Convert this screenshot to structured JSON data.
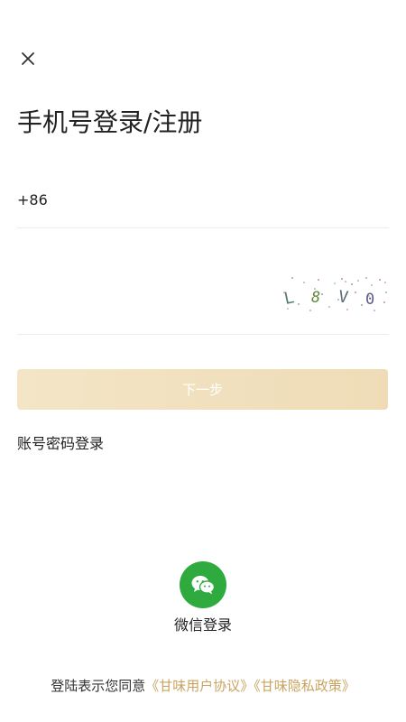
{
  "header": {
    "close_icon": "close-icon",
    "title": "手机号登录/注册"
  },
  "phone": {
    "country_code": "+86",
    "value": "",
    "placeholder": ""
  },
  "captcha": {
    "value": "",
    "placeholder": "",
    "code_text": "L8V0"
  },
  "actions": {
    "next_label": "下一步",
    "password_login_label": "账号密码登录"
  },
  "social": {
    "wechat_icon": "wechat-icon",
    "wechat_label": "微信登录",
    "wechat_color": "#2faa3f"
  },
  "agreement": {
    "prefix": "登陆表示您同意",
    "user_agreement": "《甘味用户协议》",
    "privacy_policy": "《甘味隐私政策》",
    "link_color": "#c9a461"
  }
}
